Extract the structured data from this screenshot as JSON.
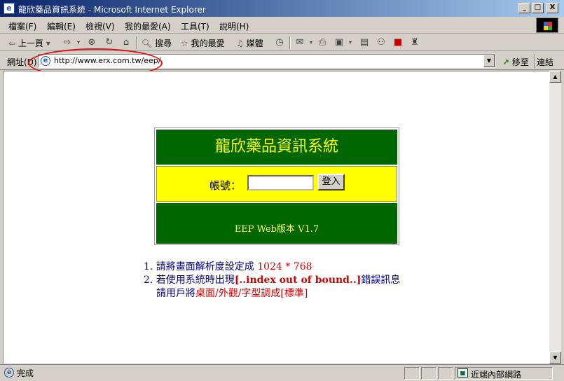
{
  "window": {
    "title": "龍欣藥品資訊系統 - Microsoft Internet Explorer",
    "minimize": "_",
    "maximize": "□",
    "close": "X"
  },
  "menu": [
    "檔案(F)",
    "編輯(E)",
    "檢視(V)",
    "我的最愛(A)",
    "工具(T)",
    "說明(H)"
  ],
  "toolbar": {
    "back_label": "上一頁",
    "search_label": "搜尋",
    "favorites_label": "我的最愛",
    "media_label": "媒體"
  },
  "address": {
    "label": "網址(D)",
    "url": "http://www.erx.com.tw/eep/",
    "go_label": "移至",
    "links_label": "連結"
  },
  "page": {
    "system_title": "龍欣藥品資訊系統",
    "account_label": "帳號：",
    "account_value": "",
    "login_button": "登入",
    "version": "EEP Web版本 V1.7",
    "note1_prefix": "1. 請將畫面解析度設定成 ",
    "note1_value": "1024 * 768",
    "note2_prefix": "2. 若使用系統時出現",
    "note2_error": "[..index out of bound..]",
    "note2_suffix": "錯誤訊息",
    "note3_prefix": "請用戶將",
    "note3_path": "桌面/外觀/字型調成[標準]"
  },
  "status": {
    "text": "完成",
    "zone": "近端內部網路"
  },
  "colors": {
    "title_bg": "#006600",
    "title_fg": "#ffff00",
    "login_bg": "#ffff00",
    "note_blue": "#00008b",
    "note_red": "#cc0000",
    "highlight": "#e01010"
  }
}
